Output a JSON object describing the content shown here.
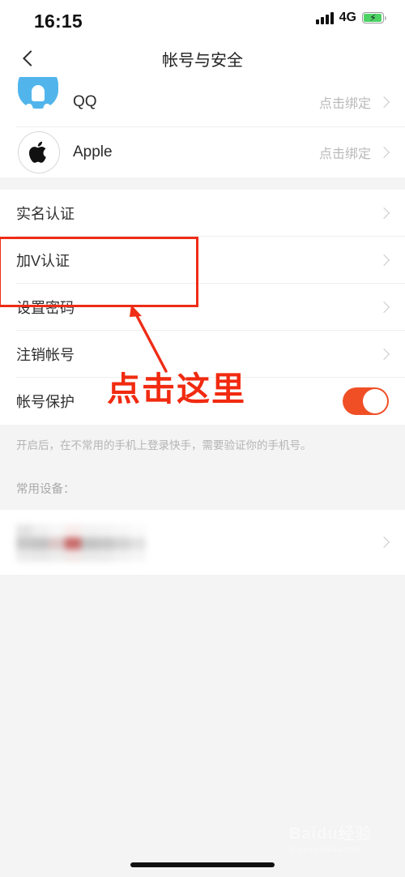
{
  "status_bar": {
    "time": "16:15",
    "network": "4G",
    "battery_icon": "battery-charging-icon",
    "bolt": "⚡"
  },
  "nav": {
    "back_icon": "chevron-left-icon",
    "title": "帐号与安全"
  },
  "social_accounts": [
    {
      "name": "QQ",
      "icon": "qq-icon",
      "action": "点击绑定"
    },
    {
      "name": "Apple",
      "icon": "apple-icon",
      "action": "点击绑定"
    }
  ],
  "settings_rows": [
    {
      "label": "实名认证",
      "chevron": "chevron-right-icon"
    },
    {
      "label": "加V认证",
      "chevron": "chevron-right-icon"
    },
    {
      "label": "设置密码",
      "chevron": "chevron-right-icon"
    },
    {
      "label": "注销帐号",
      "chevron": "chevron-right-icon"
    }
  ],
  "protection": {
    "label": "帐号保护",
    "toggle_on": true,
    "toggle_color": "#f04f26",
    "hint": "开启后，在不常用的手机上登录快手，需要验证你的手机号。"
  },
  "devices": {
    "section_label": "常用设备：",
    "row_value": "",
    "chevron": "chevron-right-icon"
  },
  "annotation": {
    "box_color": "#ef2c16",
    "arrow_color": "#ef2c16",
    "text": "点击这里",
    "text_color": "#f12a10"
  },
  "watermark": {
    "main": "Baidu经验",
    "sub": "jingyan.baidu.com"
  }
}
